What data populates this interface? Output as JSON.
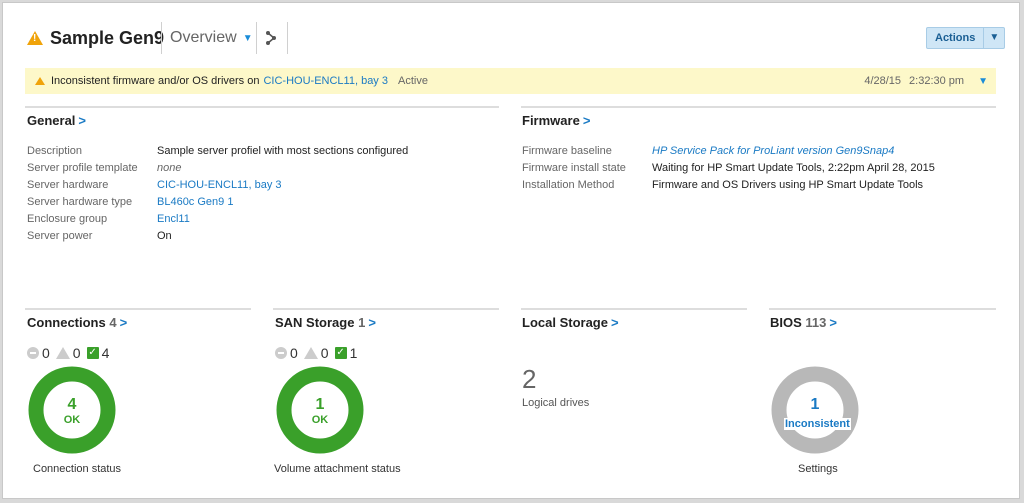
{
  "header": {
    "title": "Sample Gen9",
    "view": "Overview",
    "actions_label": "Actions"
  },
  "alert": {
    "message": "Inconsistent firmware and/or OS drivers on",
    "link": "CIC-HOU-ENCL11, bay 3",
    "state": "Active",
    "date": "4/28/15",
    "time": "2:32:30 pm"
  },
  "general": {
    "title": "General",
    "rows": [
      {
        "k": "Description",
        "v": "Sample server profiel with most sections configured"
      },
      {
        "k": "Server profile template",
        "v": "none"
      },
      {
        "k": "Server hardware",
        "v": "CIC-HOU-ENCL11, bay 3"
      },
      {
        "k": "Server hardware type",
        "v": "BL460c Gen9 1"
      },
      {
        "k": "Enclosure group",
        "v": "Encl11"
      },
      {
        "k": "Server power",
        "v": "On"
      }
    ]
  },
  "firmware": {
    "title": "Firmware",
    "rows": [
      {
        "k": "Firmware baseline",
        "v": "HP Service Pack for ProLiant version Gen9Snap4"
      },
      {
        "k": "Firmware install state",
        "v": "Waiting for HP Smart Update Tools, 2:22pm April 28, 2015"
      },
      {
        "k": "Installation Method",
        "v": "Firmware and OS Drivers using HP Smart Update Tools"
      }
    ]
  },
  "connections": {
    "title": "Connections",
    "count": "4",
    "disabled": "0",
    "warning": "0",
    "ok": "4",
    "value": "4",
    "status": "OK",
    "caption": "Connection status"
  },
  "san": {
    "title": "SAN Storage",
    "count": "1",
    "disabled": "0",
    "warning": "0",
    "ok": "1",
    "value": "1",
    "status": "OK",
    "caption": "Volume attachment status"
  },
  "local": {
    "title": "Local Storage",
    "value": "2",
    "caption": "Logical drives"
  },
  "bios": {
    "title": "BIOS",
    "count": "113",
    "value": "1",
    "status": "Inconsistent",
    "caption": "Settings"
  },
  "colors": {
    "ok": "#3aa02a",
    "warning": "#f0a30a",
    "link": "#1a7ac4",
    "inconsistent": "#b8b8b8"
  }
}
